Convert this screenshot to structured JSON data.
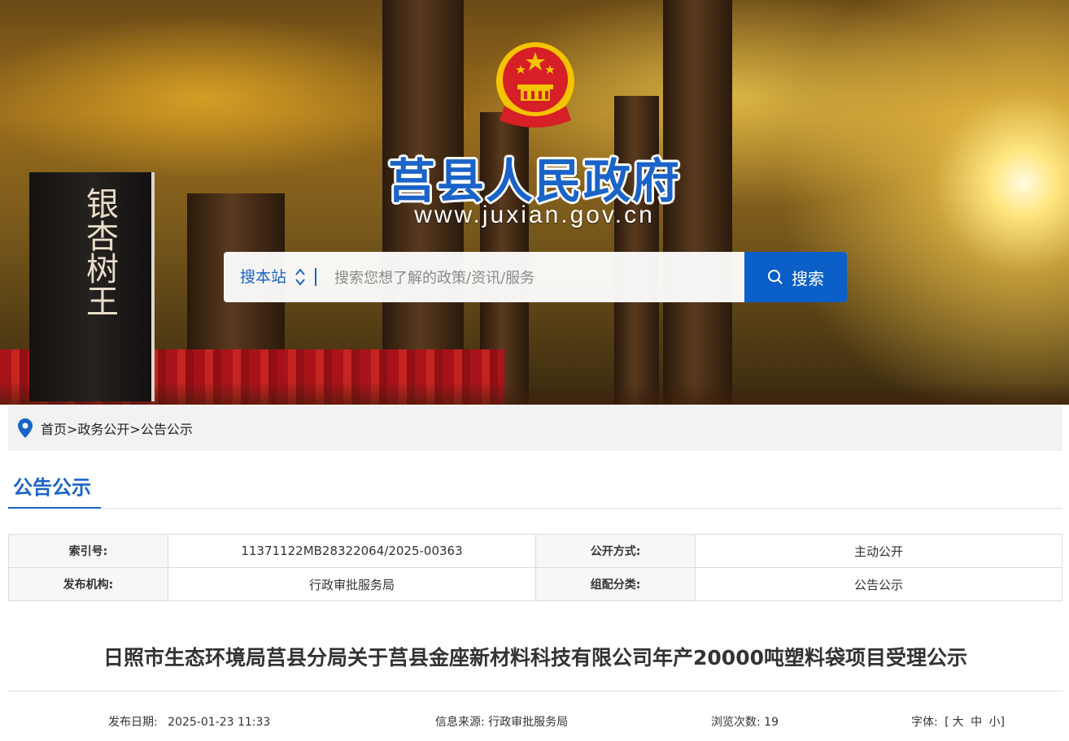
{
  "header": {
    "site_title": "莒县人民政府",
    "site_url": "www.juxian.gov.cn",
    "stone_inscription": "银杏树王",
    "search": {
      "scope_label": "搜本站",
      "placeholder": "搜索您想了解的政策/资讯/服务",
      "button_label": "搜索"
    }
  },
  "breadcrumb": {
    "text": "首页>政务公开>公告公示"
  },
  "section": {
    "title": "公告公示"
  },
  "info_table": {
    "rows": [
      {
        "label1": "索引号:",
        "value1": "11371122MB28322064/2025-00363",
        "label2": "公开方式:",
        "value2": "主动公开"
      },
      {
        "label1": "发布机构:",
        "value1": "行政审批服务局",
        "label2": "组配分类:",
        "value2": "公告公示"
      }
    ]
  },
  "article": {
    "title": "日照市生态环境局莒县分局关于莒县金座新材料科技有限公司年产20000吨塑料袋项目受理公示",
    "meta": {
      "date_label": "发布日期:",
      "date_value": "2025-01-23 11:33",
      "source_label": "信息来源:",
      "source_value": "行政审批服务局",
      "views_label": "浏览次数:",
      "views_value": "19",
      "font_label": "字体:",
      "font_open": "[",
      "font_large": "大",
      "font_medium": "中",
      "font_small": "小]"
    }
  },
  "colors": {
    "brand_blue": "#1a63c8",
    "button_blue": "#0a5fc8",
    "emblem_red": "#d61f26",
    "emblem_gold": "#f5c400"
  }
}
